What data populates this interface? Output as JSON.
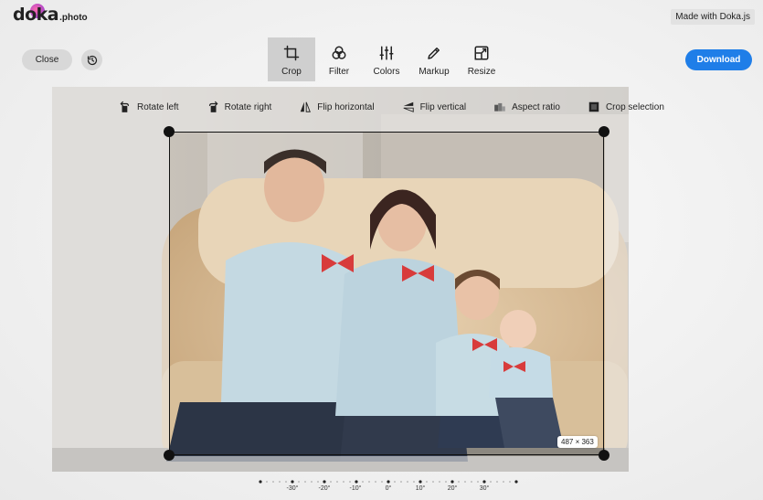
{
  "logo": {
    "brand": "doka",
    "tld": ".photo"
  },
  "header": {
    "made_with": "Made with Doka.js"
  },
  "actions": {
    "close_label": "Close",
    "history_icon": "history-icon",
    "download_label": "Download"
  },
  "tools": [
    {
      "label": "Crop",
      "icon": "crop-icon",
      "active": true
    },
    {
      "label": "Filter",
      "icon": "filter-icon",
      "active": false
    },
    {
      "label": "Colors",
      "icon": "colors-icon",
      "active": false
    },
    {
      "label": "Markup",
      "icon": "markup-icon",
      "active": false
    },
    {
      "label": "Resize",
      "icon": "resize-icon",
      "active": false
    }
  ],
  "crop_actions": [
    {
      "label": "Rotate left",
      "icon": "rotate-left-icon"
    },
    {
      "label": "Rotate right",
      "icon": "rotate-right-icon"
    },
    {
      "label": "Flip horizontal",
      "icon": "flip-horizontal-icon"
    },
    {
      "label": "Flip vertical",
      "icon": "flip-vertical-icon"
    },
    {
      "label": "Aspect ratio",
      "icon": "aspect-ratio-icon"
    },
    {
      "label": "Crop selection",
      "icon": "crop-selection-icon"
    }
  ],
  "crop": {
    "size": "487 × 363"
  },
  "rotation_dial": {
    "labels": [
      "-30°",
      "-20°",
      "-10°",
      "0°",
      "10°",
      "20°",
      "30°"
    ]
  },
  "colors": {
    "accent": "#1f7ee8",
    "active_tool_bg": "#cfcfcf"
  }
}
